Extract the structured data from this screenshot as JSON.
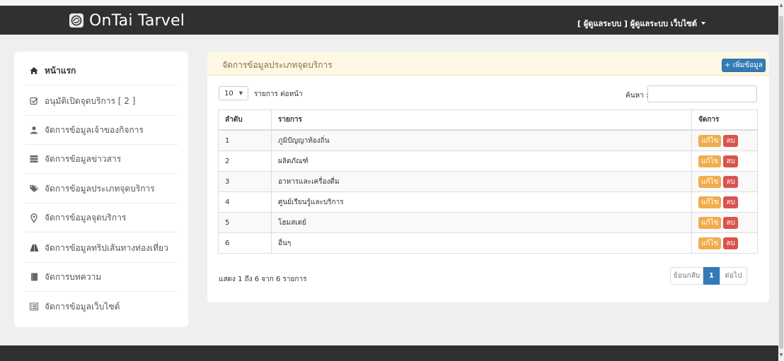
{
  "navbar": {
    "brand": "OnTai Tarvel",
    "user_menu": "[ ผู้ดูแลระบบ ] ผู้ดูแลระบบ เว็บไซต์"
  },
  "sidebar": {
    "items": [
      {
        "label": "หน้าแรก",
        "icon": "home-icon"
      },
      {
        "label": "อนุมัติเปิดจุดบริการ [ 2 ]",
        "icon": "check-square-icon"
      },
      {
        "label": "จัดการข้อมูลเจ้าของกิจการ",
        "icon": "user-icon"
      },
      {
        "label": "จัดการข้อมูลข่าวสาร",
        "icon": "list-icon"
      },
      {
        "label": "จัดการข้อมูลประเภทจุดบริการ",
        "icon": "tags-icon"
      },
      {
        "label": "จัดการข้อมูลจุดบริการ",
        "icon": "map-marker-icon"
      },
      {
        "label": "จัดการข้อมูลทริปเส้นทางท่องเที่ยว",
        "icon": "road-icon"
      },
      {
        "label": "จัดการบทความ",
        "icon": "book-icon"
      },
      {
        "label": "จัดการข้อมูลเว็บไซต์",
        "icon": "list-alt-icon"
      }
    ]
  },
  "panel": {
    "title": "จัดการข้อมูลประเภทจุดบริการ",
    "add_button": "+ เพิ่มข้อมูล",
    "length_value": "10",
    "length_label": "รายการ ต่อหน้า",
    "search_label": "ค้นหา :",
    "search_value": "",
    "table": {
      "headers": [
        "ลำดับ",
        "รายการ",
        "จัดการ"
      ],
      "edit_label": "แก้ไข",
      "delete_label": "ลบ",
      "rows": [
        {
          "no": "1",
          "name": "ภูมิปัญญาท้องถิ่น"
        },
        {
          "no": "2",
          "name": "ผลิตภัณฑ์"
        },
        {
          "no": "3",
          "name": "อาหารและเครื่องดื่ม"
        },
        {
          "no": "4",
          "name": "ศูนย์เรียนรู้และบริการ"
        },
        {
          "no": "5",
          "name": "โฮมสเตย์"
        },
        {
          "no": "6",
          "name": "อื่นๆ"
        }
      ]
    },
    "info": "แสดง 1 ถึง 6 จาก 6 รายการ",
    "pagination": {
      "prev": "ย้อนกลับ",
      "current": "1",
      "next": "ต่อไป"
    }
  },
  "colors": {
    "navbar": "#303030",
    "panel_heading": "#fcf8e3",
    "panel_title": "#8a6d3b",
    "primary": "#337ab7",
    "warning": "#f0ad4e",
    "danger": "#d9534f"
  }
}
